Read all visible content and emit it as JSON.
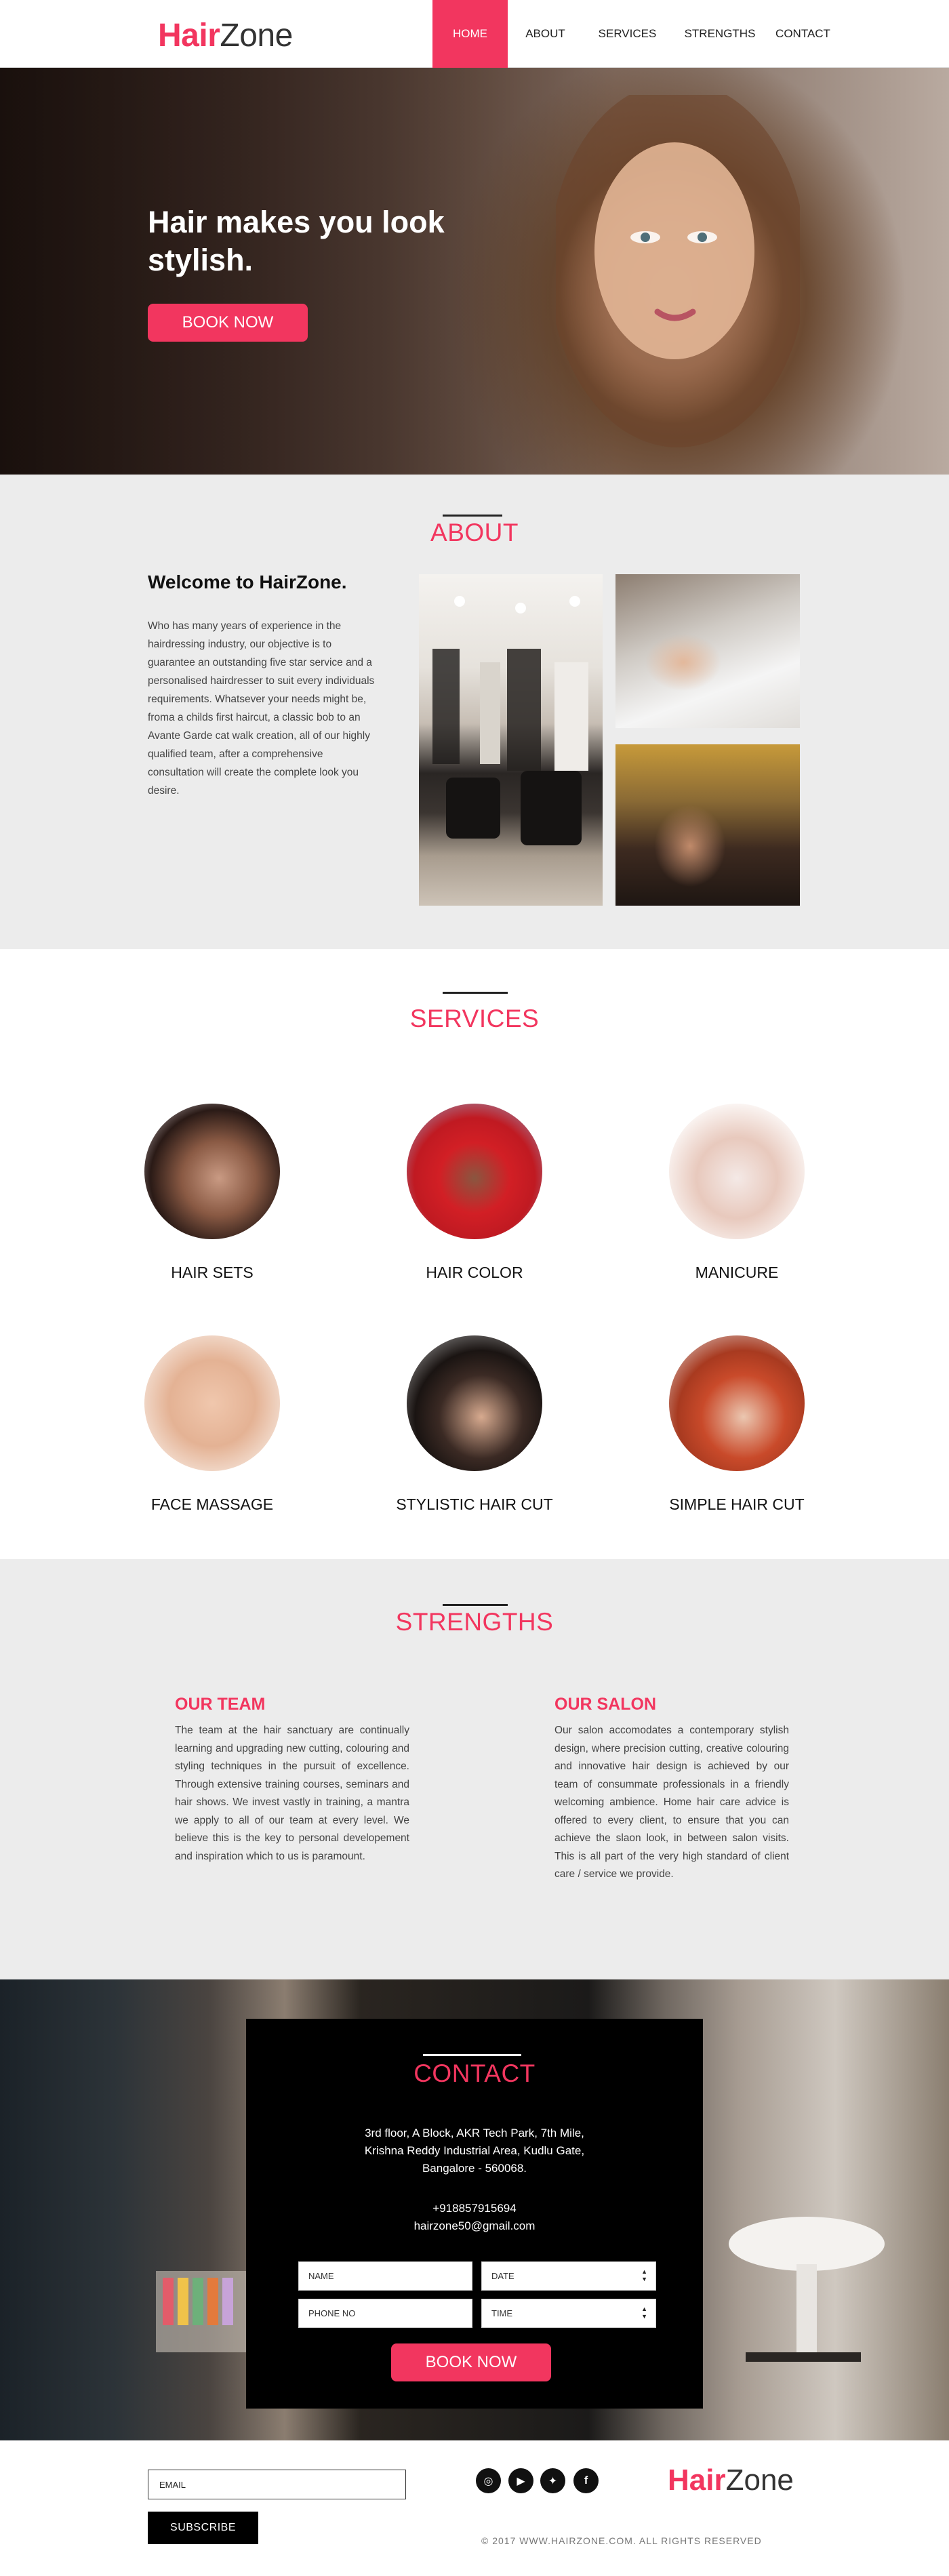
{
  "brand": {
    "hair": "Hair",
    "zone": "Zone"
  },
  "nav": {
    "items": [
      "HOME",
      "ABOUT",
      "SERVICES",
      "STRENGTHS",
      "CONTACT"
    ],
    "active": "HOME"
  },
  "hero": {
    "title_line1": "Hair makes you look",
    "title_line2": "stylish.",
    "button": "BOOK NOW"
  },
  "about": {
    "title": "ABOUT",
    "heading": "Welcome to HairZone.",
    "text": "Who has many years of experience in the hairdressing industry, our objective is to guarantee an outstanding five star service and a personalised hairdresser to suit every individuals requirements. Whatsever your needs might be, froma a childs first haircut, a classic bob to an Avante Garde cat walk creation, all of our highly qualified team, after a comprehensive consultation will create the complete look you desire."
  },
  "services": {
    "title": "SERVICES",
    "items": [
      "HAIR SETS",
      "HAIR COLOR",
      "MANICURE",
      "FACE MASSAGE",
      "STYLISTIC HAIR CUT",
      "SIMPLE HAIR CUT"
    ]
  },
  "strengths": {
    "title": "STRENGTHS",
    "team_title": "OUR TEAM",
    "team_text": "The team at the hair sanctuary are continually learning and upgrading new cutting, colouring and styling techniques in the pursuit of excellence. Through extensive training courses, seminars and hair shows. We invest vastly in training, a mantra we apply to all of our team at every level. We believe this is the key to personal developement and inspiration which to us is paramount.",
    "salon_title": "OUR SALON",
    "salon_text": "Our salon accomodates a contemporary stylish design, where precision cutting, creative colouring and innovative hair design is achieved by our team of consummate professionals in a friendly welcoming ambience. Home hair care advice is offered to every client, to ensure that you can achieve the slaon look, in between salon visits. This is all part of the very high standard of client care / service we provide."
  },
  "contact": {
    "title": "CONTACT",
    "address_1": "3rd floor, A Block, AKR Tech Park, 7th Mile,",
    "address_2": "Krishna Reddy Industrial Area, Kudlu Gate,",
    "address_3": "Bangalore - 560068.",
    "phone": "+918857915694",
    "email": "hairzone50@gmail.com",
    "fields": {
      "name": "NAME",
      "date": "DATE",
      "phone": "PHONE NO",
      "time": "TIME"
    },
    "button": "BOOK NOW"
  },
  "footer": {
    "email_placeholder": "EMAIL",
    "subscribe": "SUBSCRIBE",
    "social": [
      "instagram-icon",
      "youtube-icon",
      "twitter-icon",
      "facebook-icon"
    ],
    "copyright": "© 2017 WWW.HAIRZONE.COM. ALL RIGHTS RESERVED"
  },
  "colors": {
    "accent": "#f2365f",
    "dark": "#000000",
    "section_bg": "#ececec"
  }
}
